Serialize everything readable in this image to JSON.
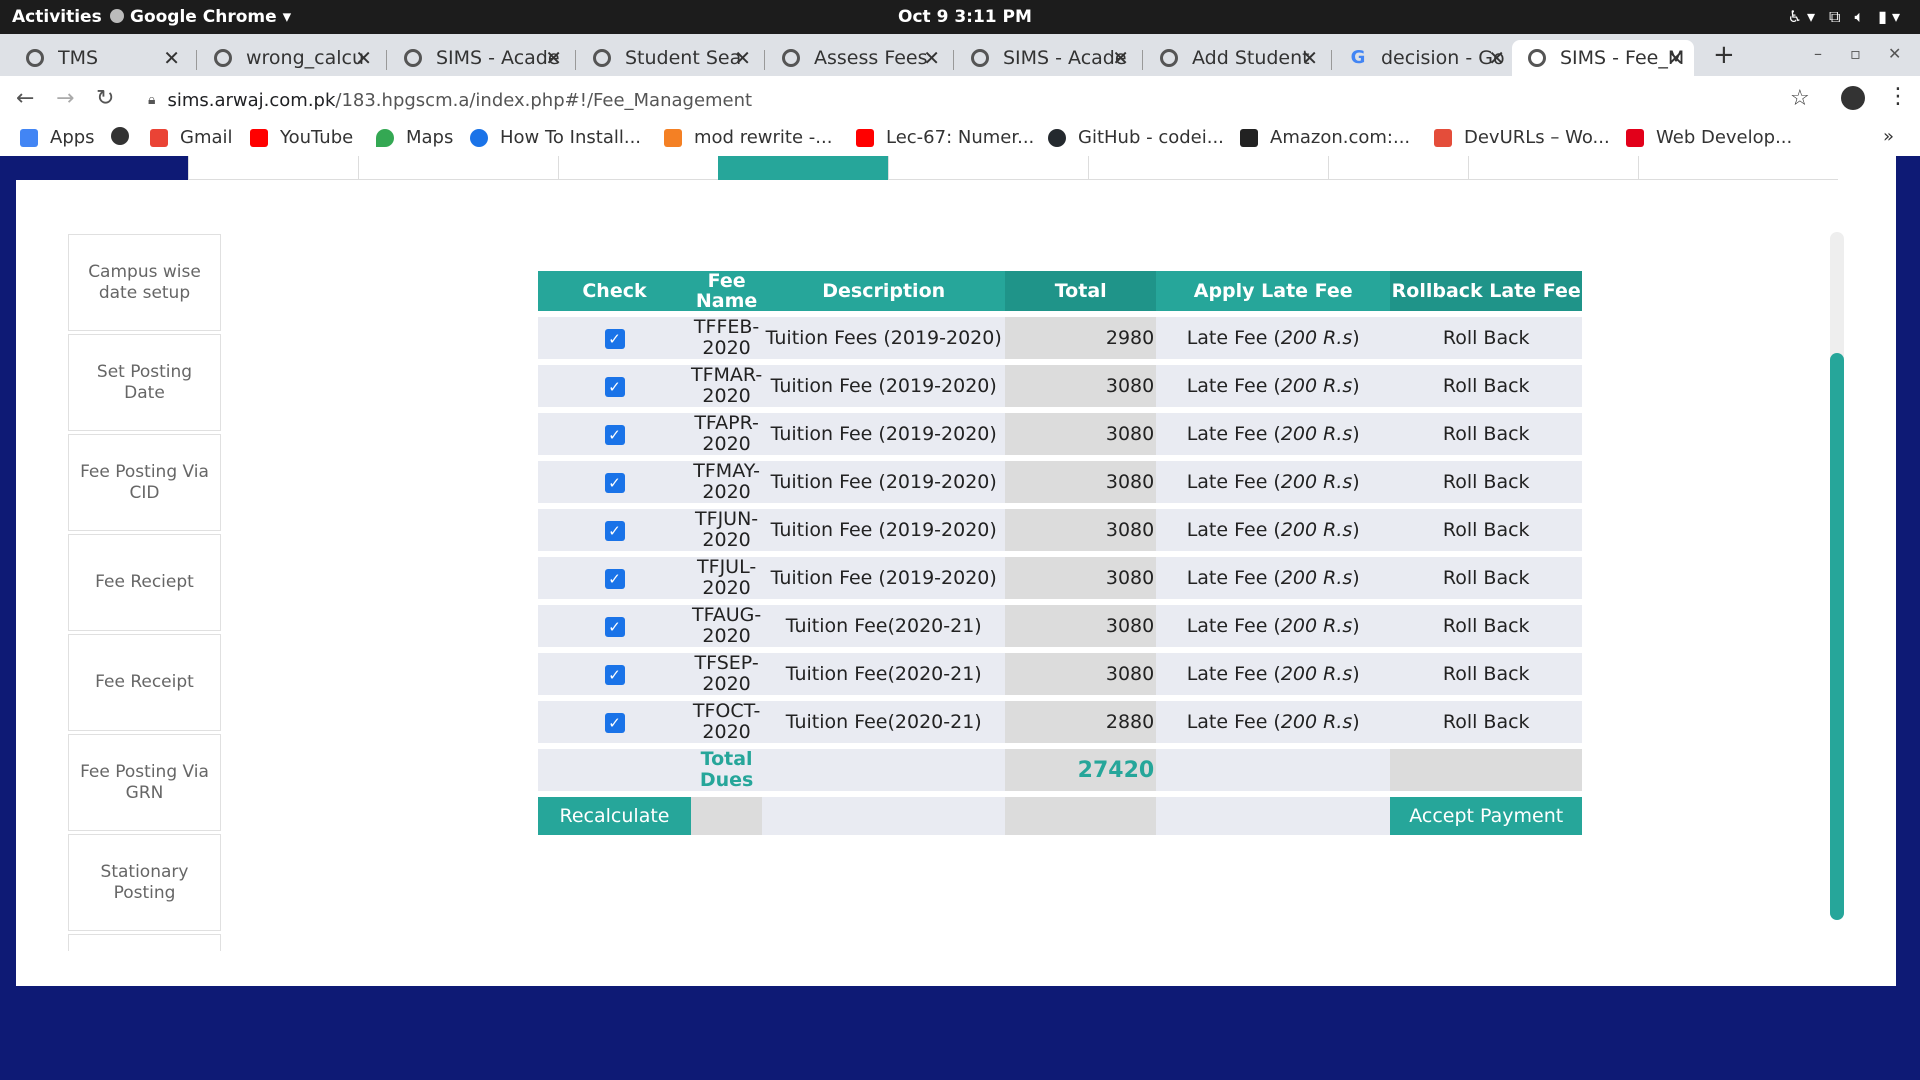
{
  "system": {
    "activities": "Activities",
    "app_name": "Google Chrome",
    "clock": "Oct 9   3:11 PM"
  },
  "tabs": [
    {
      "label": "TMS",
      "icon": "globe-icon"
    },
    {
      "label": "wrong_calcu",
      "icon": "globe-icon"
    },
    {
      "label": "SIMS - Acade",
      "icon": "globe-icon"
    },
    {
      "label": "Student Sea",
      "icon": "globe-icon"
    },
    {
      "label": "Assess Fees",
      "icon": "globe-icon"
    },
    {
      "label": "SIMS - Acade",
      "icon": "globe-icon"
    },
    {
      "label": "Add Student",
      "icon": "globe-icon"
    },
    {
      "label": "decision - Go",
      "icon": "google-icon"
    },
    {
      "label": "SIMS - Fee_M",
      "icon": "globe-icon"
    }
  ],
  "url": {
    "host": "sims.arwaj.com.pk",
    "path": "/183.hpgscm.a/index.php#!/Fee_Management"
  },
  "bookmarks": [
    {
      "label": "Apps",
      "color": "#4285f4"
    },
    {
      "label": "",
      "color": "#333333"
    },
    {
      "label": "Gmail",
      "color": "#ea4335"
    },
    {
      "label": "YouTube",
      "color": "#ff0000"
    },
    {
      "label": "Maps",
      "color": "#34a853"
    },
    {
      "label": "How To Install...",
      "color": "#1a73e8"
    },
    {
      "label": "mod rewrite -...",
      "color": "#f48024"
    },
    {
      "label": "Lec-67: Numer...",
      "color": "#ff0000"
    },
    {
      "label": "GitHub - codei...",
      "color": "#24292e"
    },
    {
      "label": "Amazon.com:...",
      "color": "#222222"
    },
    {
      "label": "DevURLs – Wo...",
      "color": "#e44d3a"
    },
    {
      "label": "Web Develop...",
      "color": "#e2001a"
    }
  ],
  "bookmarks_more": "»",
  "sidebar": [
    "Campus wise date setup",
    "Set Posting Date",
    "Fee Posting Via CID",
    "Fee Reciept",
    "Fee Receipt",
    "Fee Posting Via GRN",
    "Stationary Posting"
  ],
  "table": {
    "headers": [
      "Check",
      "Fee Name",
      "Description",
      "Total",
      "Apply Late Fee",
      "Rollback Late Fee"
    ],
    "rows": [
      {
        "fee_name_1": "TFFEB-",
        "fee_name_2": "2020",
        "description": "Tuition Fees (2019-2020)",
        "total": "2980"
      },
      {
        "fee_name_1": "TFMAR-",
        "fee_name_2": "2020",
        "description": "Tuition Fee (2019-2020)",
        "total": "3080"
      },
      {
        "fee_name_1": "TFAPR-",
        "fee_name_2": "2020",
        "description": "Tuition Fee (2019-2020)",
        "total": "3080"
      },
      {
        "fee_name_1": "TFMAY-",
        "fee_name_2": "2020",
        "description": "Tuition Fee (2019-2020)",
        "total": "3080"
      },
      {
        "fee_name_1": "TFJUN-",
        "fee_name_2": "2020",
        "description": "Tuition Fee (2019-2020)",
        "total": "3080"
      },
      {
        "fee_name_1": "TFJUL-",
        "fee_name_2": "2020",
        "description": "Tuition Fee (2019-2020)",
        "total": "3080"
      },
      {
        "fee_name_1": "TFAUG-",
        "fee_name_2": "2020",
        "description": "Tuition Fee(2020-21)",
        "total": "3080"
      },
      {
        "fee_name_1": "TFSEP-",
        "fee_name_2": "2020",
        "description": "Tuition Fee(2020-21)",
        "total": "3080"
      },
      {
        "fee_name_1": "TFOCT-",
        "fee_name_2": "2020",
        "description": "Tuition Fee(2020-21)",
        "total": "2880"
      }
    ],
    "late_fee_prefix": "Late Fee (",
    "late_fee_amount": "200 R.s",
    "late_fee_suffix": ")",
    "rollback_label": "Roll Back",
    "total_dues_label_1": "Total",
    "total_dues_label_2": "Dues",
    "total_dues_value": "27420",
    "recalculate_label": "Recalculate",
    "accept_payment_label": "Accept Payment"
  },
  "colors": {
    "accent": "#26a69a",
    "desktop_bg": "#0e1a75",
    "checkbox": "#1a73e8"
  }
}
